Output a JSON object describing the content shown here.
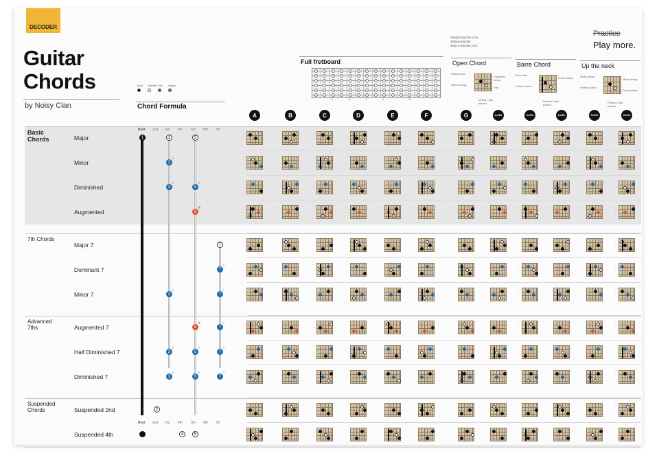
{
  "brand_badge": "DECODER",
  "title_lines": [
    "Guitar",
    "Chords"
  ],
  "byline": "by Noisy Clan",
  "legend": [
    {
      "label": "Root",
      "color": "#111111"
    },
    {
      "label": "Interval",
      "color": "#ffffff"
    },
    {
      "label": "Flat",
      "color": "#1f6aa8"
    },
    {
      "label": "Sharp",
      "color": "#d9522e"
    }
  ],
  "formula_title": "Chord Formula",
  "contact": [
    "info@noisyclan.com",
    "@thenoisyclan",
    "www.noisyclan.com"
  ],
  "slogan": {
    "struck": "Practice",
    "main": "Play more."
  },
  "info_boxes": [
    {
      "label": "Full fretboard"
    },
    {
      "label": "Open Chord",
      "notes": [
        "Guitar neck",
        "Open strings",
        "Muted / fast played",
        "Unplayed string",
        "Fret"
      ]
    },
    {
      "label": "Barre Chord",
      "notes": [
        "Barre fret",
        "Fretted notes",
        "Pitched / fast played",
        "Fret position"
      ]
    },
    {
      "label": "Up the neck",
      "notes": [
        "Open string",
        "Fretted notes",
        "Fretted / fast played",
        "Mute strings",
        "Fret position"
      ]
    }
  ],
  "fretboard_numbers": [
    "3",
    "5",
    "7",
    "9",
    "12"
  ],
  "keys": [
    "A",
    "B",
    "C",
    "D",
    "E",
    "F",
    "G",
    "A#/B♭",
    "C#/D♭",
    "D#/E♭",
    "F#/G♭",
    "G#/A♭"
  ],
  "key_display": [
    [
      "A"
    ],
    [
      "B"
    ],
    [
      "C"
    ],
    [
      "D"
    ],
    [
      "E"
    ],
    [
      "F"
    ],
    [
      "G"
    ],
    [
      "A#",
      "B♭"
    ],
    [
      "C#",
      "D♭"
    ],
    [
      "D#",
      "E♭"
    ],
    [
      "F#",
      "G♭"
    ],
    [
      "G#",
      "A♭"
    ]
  ],
  "intervals": [
    "Root",
    "2nd",
    "3rd",
    "4th",
    "5th",
    "6th",
    "7th"
  ],
  "categories": [
    {
      "name": "Basic Chords",
      "lines": [
        "Basic",
        "Chords"
      ],
      "shaded": true,
      "rows": [
        {
          "name": "Major",
          "formula": [
            {
              "i": "3rd",
              "t": "nat",
              "n": "3"
            },
            {
              "i": "5th",
              "t": "nat",
              "n": "5"
            }
          ]
        },
        {
          "name": "Minor",
          "formula": [
            {
              "i": "3rd",
              "t": "flat",
              "n": "3"
            }
          ]
        },
        {
          "name": "Diminished",
          "formula": [
            {
              "i": "3rd",
              "t": "flat",
              "n": "3"
            },
            {
              "i": "5th",
              "t": "flat",
              "n": "5"
            }
          ]
        },
        {
          "name": "Augmented",
          "formula": [
            {
              "i": "5th",
              "t": "sharp",
              "n": "5"
            }
          ]
        }
      ]
    },
    {
      "name": "7th Chords",
      "lines": [
        "7th Chords"
      ],
      "shaded": false,
      "rows": [
        {
          "name": "Major 7",
          "formula": [
            {
              "i": "7th",
              "t": "nat",
              "n": "7"
            }
          ]
        },
        {
          "name": "Dominant 7",
          "formula": [
            {
              "i": "7th",
              "t": "flat",
              "n": "7"
            }
          ]
        },
        {
          "name": "Minor 7",
          "formula": [
            {
              "i": "3rd",
              "t": "flat",
              "n": "3"
            },
            {
              "i": "7th",
              "t": "flat",
              "n": "7"
            }
          ]
        }
      ]
    },
    {
      "name": "Advanced 7ths",
      "lines": [
        "Advanced",
        "7ths"
      ],
      "shaded": false,
      "rows": [
        {
          "name": "Augmented 7",
          "formula": [
            {
              "i": "5th",
              "t": "sharp",
              "n": "5"
            },
            {
              "i": "7th",
              "t": "flat",
              "n": "7"
            }
          ]
        },
        {
          "name": "Half Diminished 7",
          "formula": [
            {
              "i": "3rd",
              "t": "flat",
              "n": "3"
            },
            {
              "i": "5th",
              "t": "flat",
              "n": "5"
            },
            {
              "i": "7th",
              "t": "flat",
              "n": "7"
            }
          ]
        },
        {
          "name": "Diminished 7",
          "formula": [
            {
              "i": "3rd",
              "t": "flat",
              "n": "3"
            },
            {
              "i": "5th",
              "t": "flat",
              "n": "5"
            },
            {
              "i": "7th",
              "t": "flat",
              "n": "7"
            }
          ]
        }
      ]
    },
    {
      "name": "Suspended Chords",
      "lines": [
        "Suspended",
        "Chords"
      ],
      "shaded": false,
      "rows": [
        {
          "name": "Suspended 2nd",
          "formula": [
            {
              "i": "2nd",
              "t": "nat",
              "n": "2"
            }
          ]
        },
        {
          "name": "Suspended 4th",
          "formula": [
            {
              "i": "4th",
              "t": "nat",
              "n": "4"
            },
            {
              "i": "5th",
              "t": "nat",
              "n": "5"
            }
          ]
        }
      ]
    }
  ],
  "colors": {
    "accent": "#f2b636",
    "flat": "#1f6aa8",
    "sharp": "#d9522e",
    "fretboard": "#d6c4a8",
    "band": "#e6e6e6"
  }
}
